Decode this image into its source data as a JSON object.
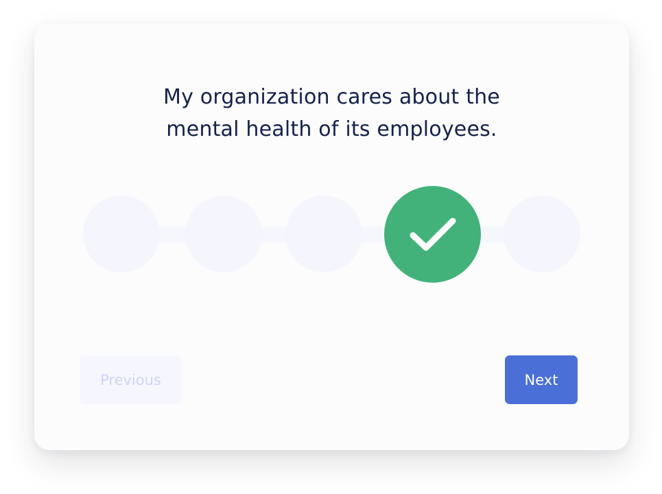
{
  "question": {
    "line1": "My organization cares about the",
    "line2": "mental health of its employees."
  },
  "scale": {
    "options_count": 5,
    "selected_index": 4,
    "selected_color": "#42b27a",
    "unselected_color": "#f5f6fd"
  },
  "nav": {
    "previous_label": "Previous",
    "next_label": "Next",
    "next_color": "#4a6fd6"
  }
}
